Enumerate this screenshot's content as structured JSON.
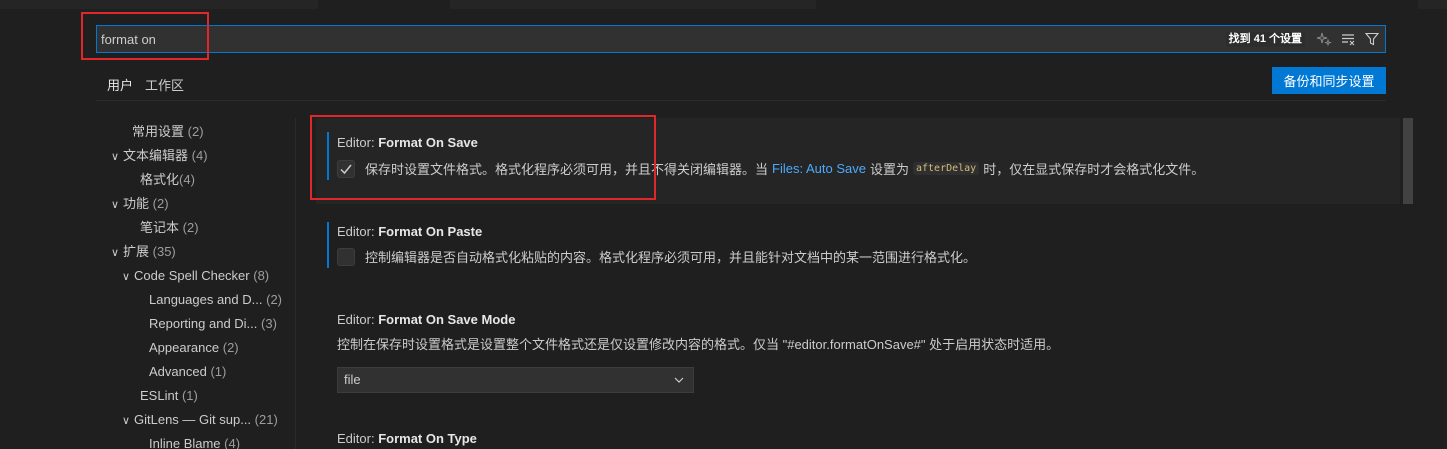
{
  "search": {
    "value": "format on",
    "result_count": "找到 41 个设置",
    "icons": [
      "sparkle-icon",
      "clear-filter-icon",
      "filter-icon"
    ]
  },
  "scope_tabs": [
    {
      "label": "用户",
      "active": true
    },
    {
      "label": "工作区",
      "active": false
    }
  ],
  "backup_button": "备份和同步设置",
  "toc": [
    {
      "label": "常用设置",
      "count": "(2)",
      "chevron": ""
    },
    {
      "label": "文本编辑器",
      "count": "(4)",
      "chevron": "∨"
    },
    {
      "label": "格式化",
      "count": "(4)",
      "chevron": ""
    },
    {
      "label": "功能",
      "count": "(2)",
      "chevron": "∨"
    },
    {
      "label": "笔记本",
      "count": "(2)",
      "chevron": ""
    },
    {
      "label": "扩展",
      "count": "(35)",
      "chevron": "∨"
    },
    {
      "label": "Code Spell Checker",
      "count": "(8)",
      "chevron": "∨"
    },
    {
      "label": "Languages and D...",
      "count": "(2)",
      "chevron": ""
    },
    {
      "label": "Reporting and Di...",
      "count": "(3)",
      "chevron": ""
    },
    {
      "label": "Appearance",
      "count": "(2)",
      "chevron": ""
    },
    {
      "label": "Advanced",
      "count": "(1)",
      "chevron": ""
    },
    {
      "label": "ESLint",
      "count": "(1)",
      "chevron": ""
    },
    {
      "label": "GitLens — Git sup...",
      "count": "(21)",
      "chevron": "∨"
    },
    {
      "label": "Inline Blame",
      "count": "(4)",
      "chevron": ""
    }
  ],
  "settings": {
    "format_on_save": {
      "category": "Editor: ",
      "name": "Format On Save",
      "checked": true,
      "desc_before": "保存时设置文件格式。格式化程序必须可用，并且不得关闭编辑器。当",
      "link": "Files: Auto Save",
      "desc_mid": "设置为",
      "code": "afterDelay",
      "desc_after": "时，仅在显式保存时才会格式化文件。"
    },
    "format_on_paste": {
      "category": "Editor: ",
      "name": "Format On Paste",
      "checked": false,
      "desc": "控制编辑器是否自动格式化粘贴的内容。格式化程序必须可用，并且能针对文档中的某一范围进行格式化。"
    },
    "format_on_save_mode": {
      "category": "Editor: ",
      "name": "Format On Save Mode",
      "desc": "控制在保存时设置格式是设置整个文件格式还是仅设置修改内容的格式。仅当 \"#editor.formatOnSave#\" 处于启用状态时适用。",
      "value": "file"
    },
    "format_on_type": {
      "category": "Editor: ",
      "name": "Format On Type"
    }
  },
  "colors": {
    "accent": "#0078d4",
    "highlight_box": "#e0282a",
    "link": "#4daafc"
  }
}
